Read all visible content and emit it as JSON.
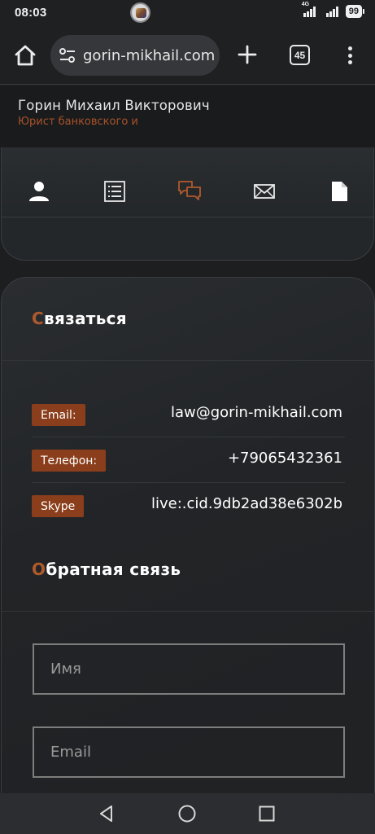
{
  "status_bar": {
    "time": "08:03",
    "network_tag": "4G",
    "battery": "99"
  },
  "browser": {
    "url": "gorin-mikhail.com",
    "tab_count": "45"
  },
  "site": {
    "name": "Горин Михаил Викторович",
    "subtitle": "Юрист банковского и"
  },
  "nav_icons": [
    "person-icon",
    "list-icon",
    "chat-icon",
    "mail-icon",
    "document-icon"
  ],
  "contact": {
    "title_first": "С",
    "title_rest": "вязаться",
    "rows": [
      {
        "label": "Email:",
        "value": "law@gorin-mikhail.com"
      },
      {
        "label": "Телефон:",
        "value": "+79065432361"
      },
      {
        "label": "Skype",
        "value": "live:.cid.9db2ad38e6302b"
      }
    ]
  },
  "feedback": {
    "title_first": "О",
    "title_rest": "братная связь",
    "name_placeholder": "Имя",
    "email_placeholder": "Email"
  },
  "colors": {
    "accent": "#b05a2c",
    "badge": "#8a3e1b",
    "background": "#1c1e20"
  }
}
